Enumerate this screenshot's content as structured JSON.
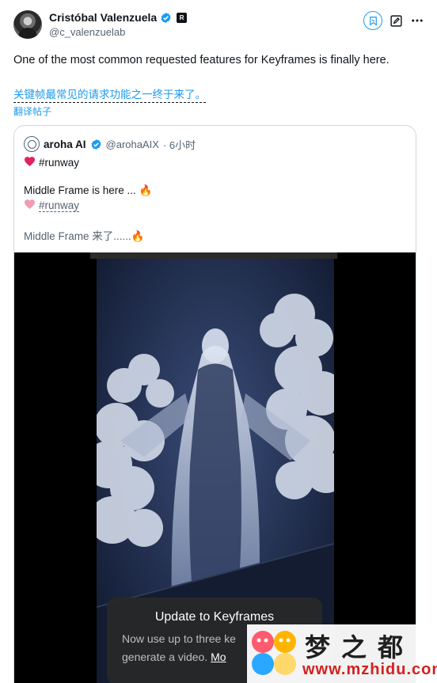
{
  "author": {
    "name": "Cristóbal Valenzuela",
    "handle": "@c_valenzuelab",
    "affiliation_glyph": "R"
  },
  "tweet": {
    "text": "One of the most common requested features for Keyframes is finally here.",
    "translation": "关键帧最常见的请求功能之一终于来了。",
    "translate_link": "翻译帖子"
  },
  "quote": {
    "name": "aroha AI",
    "handle": "@arohaAIX",
    "time": "· 6小时",
    "line1_tag": "#runway",
    "line2": "Middle Frame is here ... 🔥",
    "line3_tag": "#runway",
    "line4": "Middle Frame 来了......🔥"
  },
  "media_toast": {
    "title": "Update to Keyframes",
    "body_line1": "Now use up to three ke",
    "body_line2": "generate a video. ",
    "more": "Mo"
  },
  "watermark": {
    "chinese": "梦之都",
    "url": "www.mzhidu.com"
  },
  "icons": [
    "verified-badge-icon",
    "grok-icon",
    "edit-icon",
    "more-icon",
    "heart-icon"
  ],
  "colors": {
    "accent": "#1d9bf0",
    "text": "#0f1419",
    "muted": "#536471",
    "border": "#cfd9de",
    "heart_red": "#e0245e",
    "heart_pink": "#f29cb4"
  }
}
